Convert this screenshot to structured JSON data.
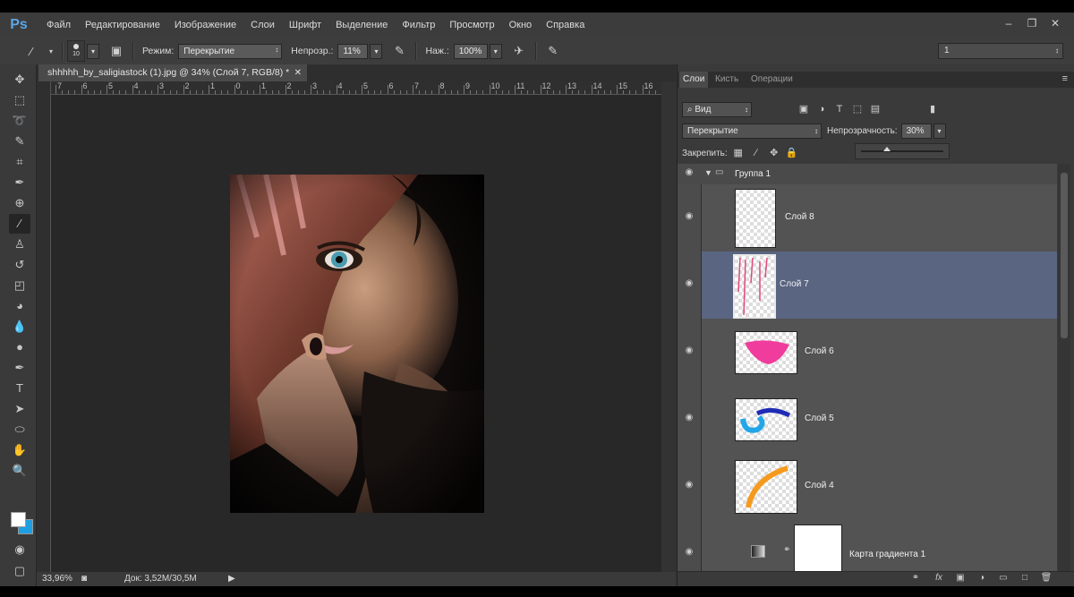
{
  "menu": {
    "logo": "Ps",
    "items": [
      "Файл",
      "Редактирование",
      "Изображение",
      "Слои",
      "Шрифт",
      "Выделение",
      "Фильтр",
      "Просмотр",
      "Окно",
      "Справка"
    ]
  },
  "options": {
    "brush_size": "10",
    "mode_label": "Режим:",
    "mode_value": "Перекрытие",
    "opacity_label": "Непрозр.:",
    "opacity_value": "11%",
    "pressure_label": "Наж.:",
    "pressure_value": "100%",
    "workspace_value": "1"
  },
  "document": {
    "tab_title": "shhhhh_by_saligiastock (1).jpg @ 34% (Слой 7, RGB/8) *",
    "ruler_top": [
      "7",
      "6",
      "5",
      "4",
      "3",
      "2",
      "1",
      "0",
      "1",
      "2",
      "3",
      "4",
      "5",
      "6",
      "7",
      "8",
      "9",
      "10",
      "11",
      "12",
      "13",
      "14",
      "15",
      "16"
    ],
    "zoom": "33,96%",
    "doc_size": "Док: 3,52M/30,5M"
  },
  "layers_panel": {
    "tabs": [
      "Слои",
      "Кисть",
      "Операции"
    ],
    "filter_label": "Вид",
    "blend_mode": "Перекрытие",
    "opacity_label": "Непрозрачность:",
    "opacity_value": "30%",
    "lock_label": "Закрепить:",
    "group_name": "Группа 1",
    "layers": [
      {
        "name": "Слой 8"
      },
      {
        "name": "Слой 7"
      },
      {
        "name": "Слой 6"
      },
      {
        "name": "Слой 5"
      },
      {
        "name": "Слой 4"
      },
      {
        "name": "Карта градиента 1"
      }
    ]
  },
  "colors": {
    "accent": "#1e9fe3",
    "selected_layer": "#5a6582",
    "panel_bg": "#3a3a3a",
    "canvas_bg": "#282828"
  }
}
